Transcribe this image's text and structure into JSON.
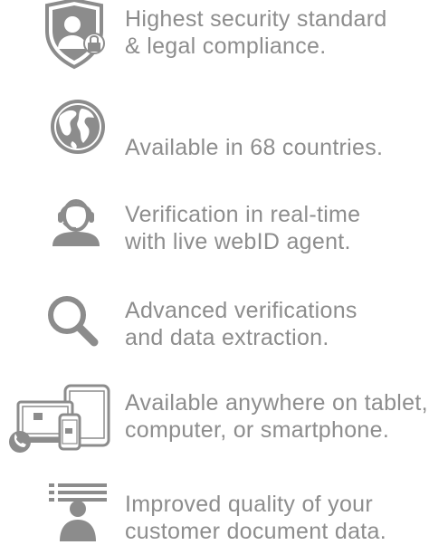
{
  "features": [
    {
      "icon": "shield-user-lock-icon",
      "line1": "Highest security standard",
      "line2": "& legal compliance."
    },
    {
      "icon": "globe-icon",
      "line1": "Available in 68 countries.",
      "line2": ""
    },
    {
      "icon": "headset-agent-icon",
      "line1": "Verification in real-time",
      "line2": "with live webID agent."
    },
    {
      "icon": "magnifier-icon",
      "line1": "Advanced verifications",
      "line2": "and data extraction."
    },
    {
      "icon": "devices-icon",
      "line1": "Available anywhere on tablet,",
      "line2": "computer, or smartphone."
    },
    {
      "icon": "document-user-icon",
      "line1": "Improved quality of your",
      "line2": "customer document data."
    }
  ],
  "colors": {
    "icon": "#8c8c8c",
    "text": "#8d8d8d",
    "background": "#ffffff"
  }
}
